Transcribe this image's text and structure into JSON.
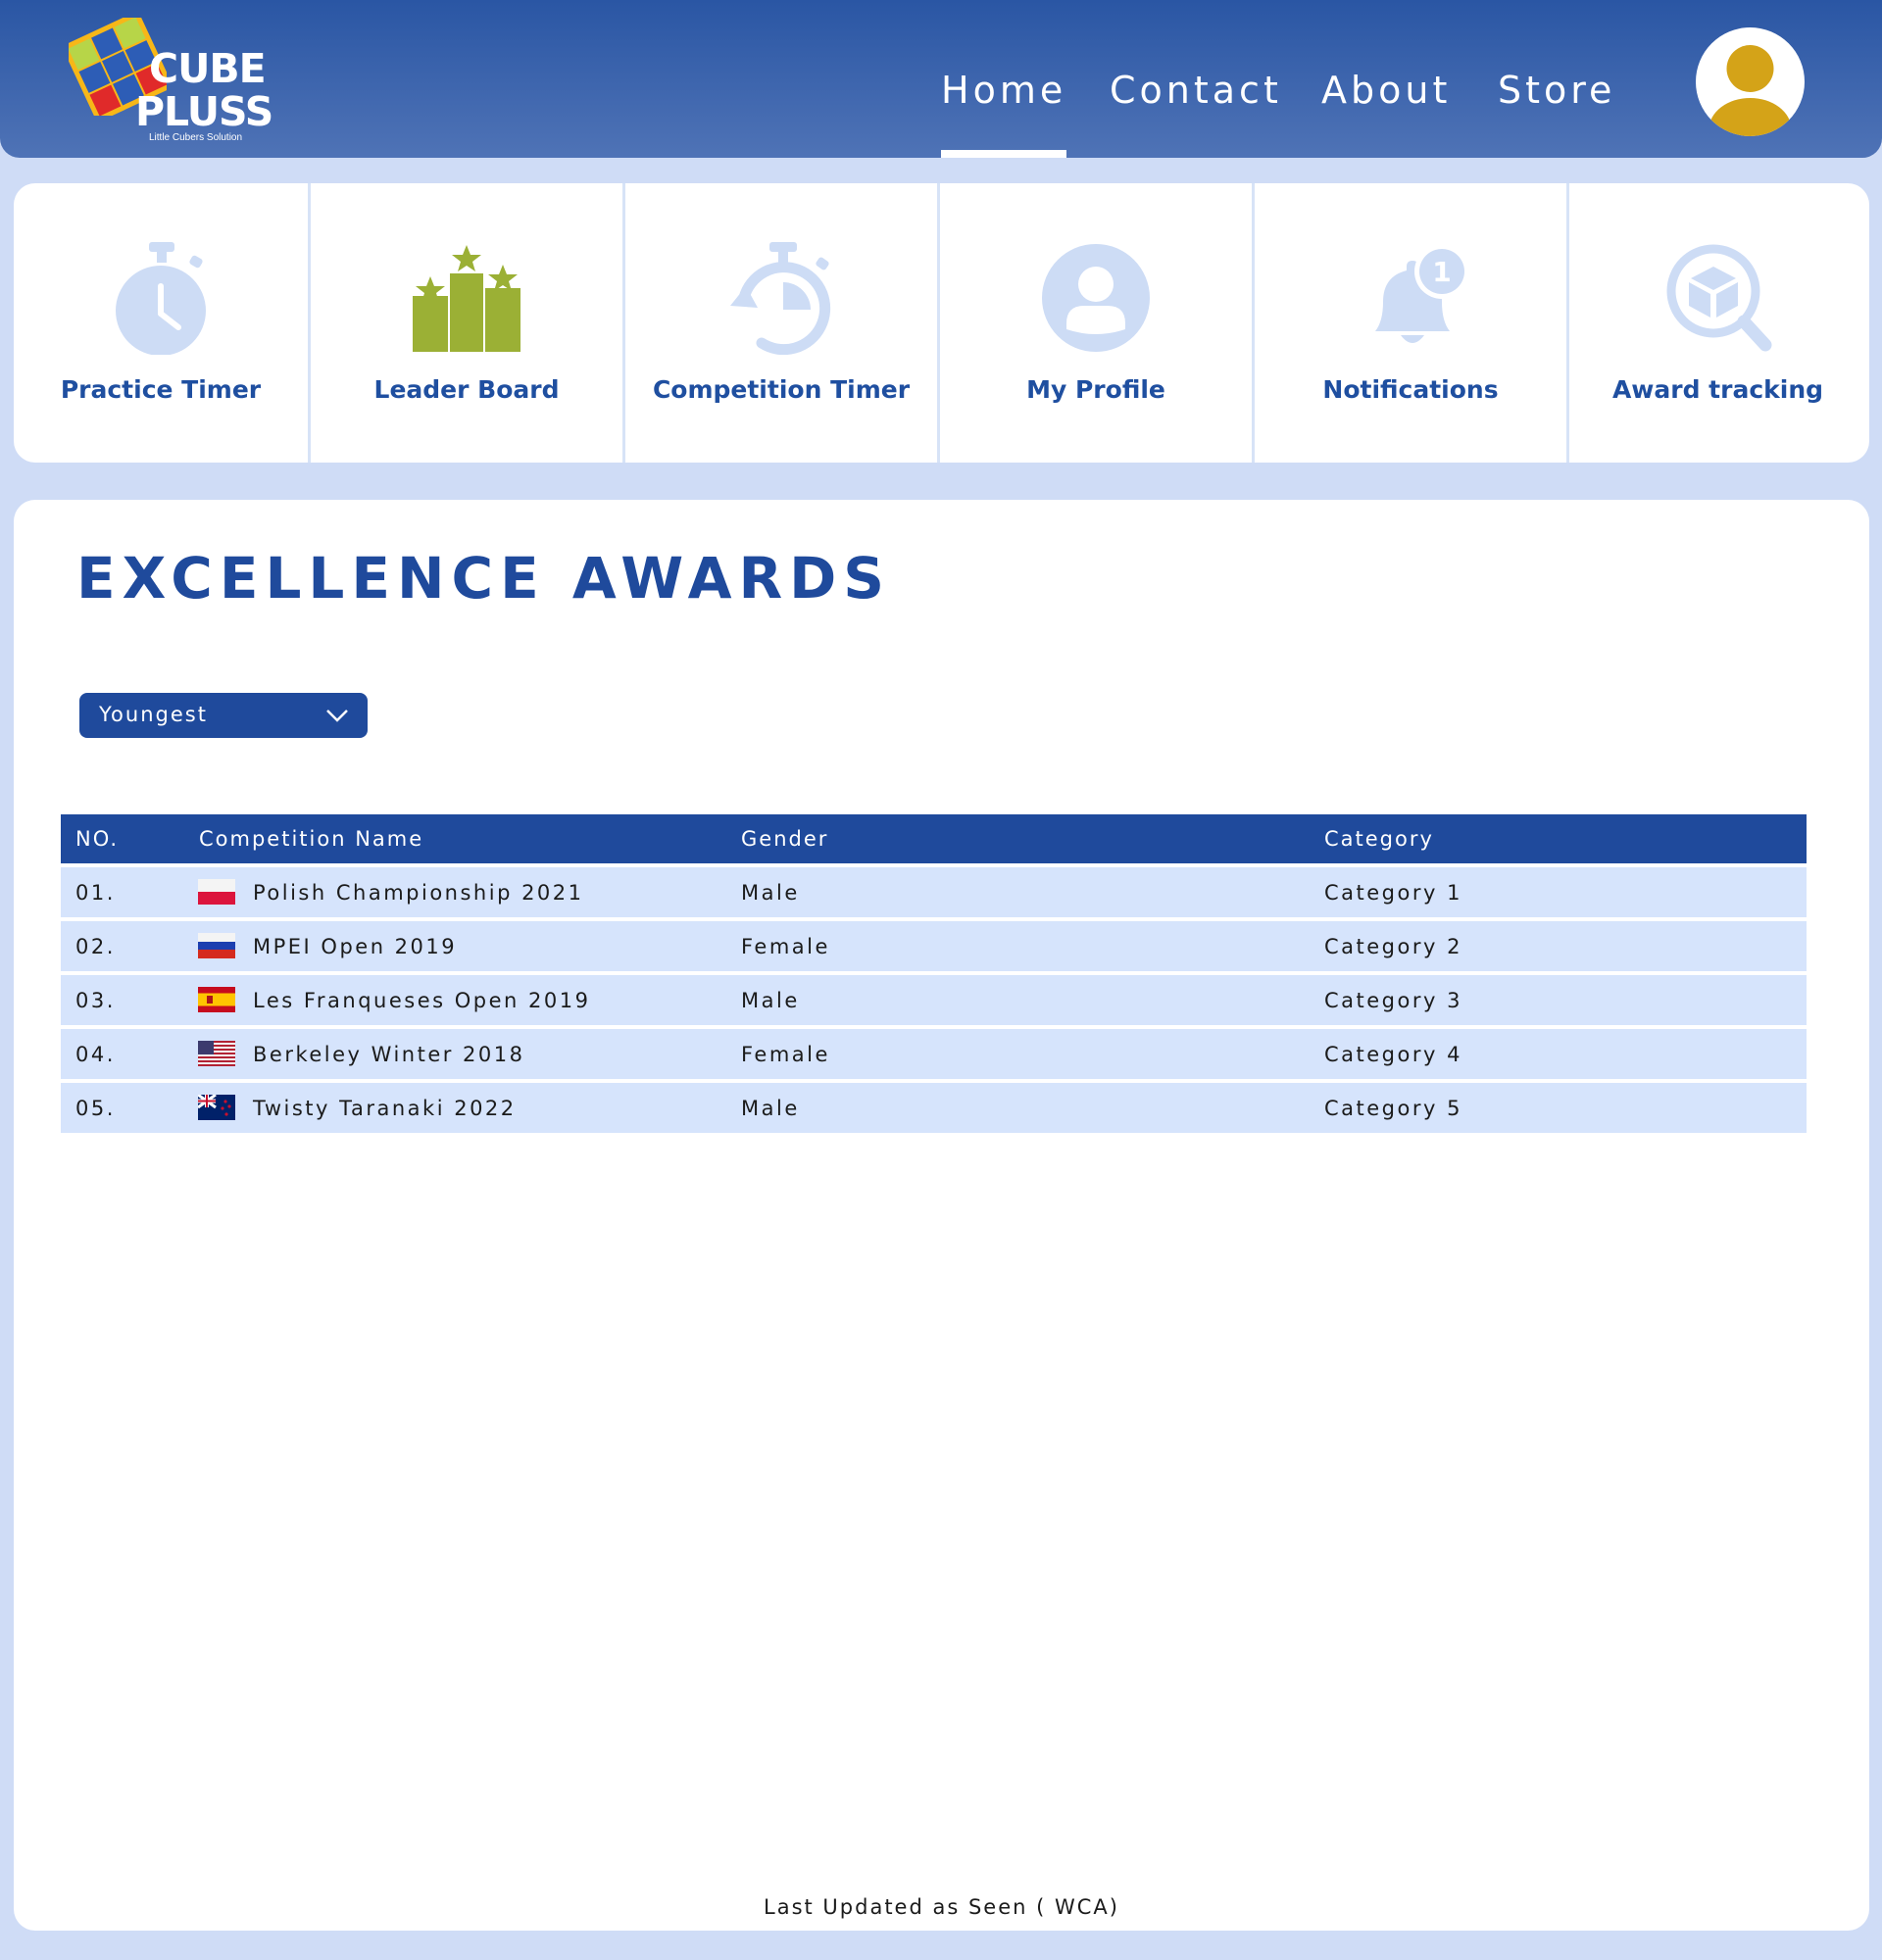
{
  "brand": {
    "line1": "CUBE",
    "line2": "PLUSS",
    "tagline": "Little Cubers Solution"
  },
  "nav": {
    "items": [
      {
        "label": "Home",
        "active": true
      },
      {
        "label": "Contact",
        "active": false
      },
      {
        "label": "About",
        "active": false
      },
      {
        "label": "Store",
        "active": false
      }
    ]
  },
  "user": {
    "avatar_icon": "user-avatar-icon"
  },
  "tiles": [
    {
      "label": "Practice Timer",
      "icon": "stopwatch-icon"
    },
    {
      "label": "Leader Board",
      "icon": "podium-stars-icon"
    },
    {
      "label": "Competition Timer",
      "icon": "timer-icon"
    },
    {
      "label": "My Profile",
      "icon": "user-circle-icon"
    },
    {
      "label": "Notifications",
      "icon": "bell-icon"
    },
    {
      "label": "Award tracking",
      "icon": "cube-search-icon"
    }
  ],
  "awards": {
    "title": "EXCELLENCE AWARDS",
    "filter": {
      "selected": "Youngest"
    },
    "table": {
      "headers": {
        "no": "NO.",
        "name": "Competition Name",
        "gender": "Gender",
        "category": "Category"
      },
      "rows": [
        {
          "no": "01.",
          "flag": "poland",
          "name": "Polish Championship 2021",
          "gender": "Male",
          "category": "Category 1"
        },
        {
          "no": "02.",
          "flag": "russia",
          "name": "MPEI Open 2019",
          "gender": "Female",
          "category": "Category 2"
        },
        {
          "no": "03.",
          "flag": "spain",
          "name": "Les Franqueses Open 2019",
          "gender": "Male",
          "category": "Category 3"
        },
        {
          "no": "04.",
          "flag": "usa",
          "name": "Berkeley Winter 2018",
          "gender": "Female",
          "category": "Category 4"
        },
        {
          "no": "05.",
          "flag": "new-zealand",
          "name": "Twisty Taranaki 2022",
          "gender": "Male",
          "category": "Category 5"
        }
      ]
    },
    "footer_note": "Last Updated as Seen ( WCA)"
  },
  "colors": {
    "header_blue": "#2a56a4",
    "primary": "#1f4a9c",
    "row_bg": "#d6e4fc",
    "icon_light": "#cddcf5",
    "leaderboard_green": "#9bb035",
    "avatar_gold": "#d4a318"
  }
}
